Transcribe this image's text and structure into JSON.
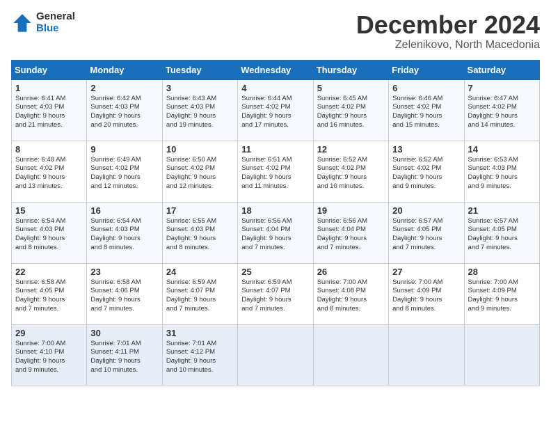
{
  "logo": {
    "general": "General",
    "blue": "Blue"
  },
  "title": "December 2024",
  "location": "Zelenikovo, North Macedonia",
  "headers": [
    "Sunday",
    "Monday",
    "Tuesday",
    "Wednesday",
    "Thursday",
    "Friday",
    "Saturday"
  ],
  "weeks": [
    [
      {
        "day": "1",
        "lines": [
          "Sunrise: 6:41 AM",
          "Sunset: 4:03 PM",
          "Daylight: 9 hours",
          "and 21 minutes."
        ]
      },
      {
        "day": "2",
        "lines": [
          "Sunrise: 6:42 AM",
          "Sunset: 4:03 PM",
          "Daylight: 9 hours",
          "and 20 minutes."
        ]
      },
      {
        "day": "3",
        "lines": [
          "Sunrise: 6:43 AM",
          "Sunset: 4:03 PM",
          "Daylight: 9 hours",
          "and 19 minutes."
        ]
      },
      {
        "day": "4",
        "lines": [
          "Sunrise: 6:44 AM",
          "Sunset: 4:02 PM",
          "Daylight: 9 hours",
          "and 17 minutes."
        ]
      },
      {
        "day": "5",
        "lines": [
          "Sunrise: 6:45 AM",
          "Sunset: 4:02 PM",
          "Daylight: 9 hours",
          "and 16 minutes."
        ]
      },
      {
        "day": "6",
        "lines": [
          "Sunrise: 6:46 AM",
          "Sunset: 4:02 PM",
          "Daylight: 9 hours",
          "and 15 minutes."
        ]
      },
      {
        "day": "7",
        "lines": [
          "Sunrise: 6:47 AM",
          "Sunset: 4:02 PM",
          "Daylight: 9 hours",
          "and 14 minutes."
        ]
      }
    ],
    [
      {
        "day": "8",
        "lines": [
          "Sunrise: 6:48 AM",
          "Sunset: 4:02 PM",
          "Daylight: 9 hours",
          "and 13 minutes."
        ]
      },
      {
        "day": "9",
        "lines": [
          "Sunrise: 6:49 AM",
          "Sunset: 4:02 PM",
          "Daylight: 9 hours",
          "and 12 minutes."
        ]
      },
      {
        "day": "10",
        "lines": [
          "Sunrise: 6:50 AM",
          "Sunset: 4:02 PM",
          "Daylight: 9 hours",
          "and 12 minutes."
        ]
      },
      {
        "day": "11",
        "lines": [
          "Sunrise: 6:51 AM",
          "Sunset: 4:02 PM",
          "Daylight: 9 hours",
          "and 11 minutes."
        ]
      },
      {
        "day": "12",
        "lines": [
          "Sunrise: 6:52 AM",
          "Sunset: 4:02 PM",
          "Daylight: 9 hours",
          "and 10 minutes."
        ]
      },
      {
        "day": "13",
        "lines": [
          "Sunrise: 6:52 AM",
          "Sunset: 4:02 PM",
          "Daylight: 9 hours",
          "and 9 minutes."
        ]
      },
      {
        "day": "14",
        "lines": [
          "Sunrise: 6:53 AM",
          "Sunset: 4:03 PM",
          "Daylight: 9 hours",
          "and 9 minutes."
        ]
      }
    ],
    [
      {
        "day": "15",
        "lines": [
          "Sunrise: 6:54 AM",
          "Sunset: 4:03 PM",
          "Daylight: 9 hours",
          "and 8 minutes."
        ]
      },
      {
        "day": "16",
        "lines": [
          "Sunrise: 6:54 AM",
          "Sunset: 4:03 PM",
          "Daylight: 9 hours",
          "and 8 minutes."
        ]
      },
      {
        "day": "17",
        "lines": [
          "Sunrise: 6:55 AM",
          "Sunset: 4:03 PM",
          "Daylight: 9 hours",
          "and 8 minutes."
        ]
      },
      {
        "day": "18",
        "lines": [
          "Sunrise: 6:56 AM",
          "Sunset: 4:04 PM",
          "Daylight: 9 hours",
          "and 7 minutes."
        ]
      },
      {
        "day": "19",
        "lines": [
          "Sunrise: 6:56 AM",
          "Sunset: 4:04 PM",
          "Daylight: 9 hours",
          "and 7 minutes."
        ]
      },
      {
        "day": "20",
        "lines": [
          "Sunrise: 6:57 AM",
          "Sunset: 4:05 PM",
          "Daylight: 9 hours",
          "and 7 minutes."
        ]
      },
      {
        "day": "21",
        "lines": [
          "Sunrise: 6:57 AM",
          "Sunset: 4:05 PM",
          "Daylight: 9 hours",
          "and 7 minutes."
        ]
      }
    ],
    [
      {
        "day": "22",
        "lines": [
          "Sunrise: 6:58 AM",
          "Sunset: 4:05 PM",
          "Daylight: 9 hours",
          "and 7 minutes."
        ]
      },
      {
        "day": "23",
        "lines": [
          "Sunrise: 6:58 AM",
          "Sunset: 4:06 PM",
          "Daylight: 9 hours",
          "and 7 minutes."
        ]
      },
      {
        "day": "24",
        "lines": [
          "Sunrise: 6:59 AM",
          "Sunset: 4:07 PM",
          "Daylight: 9 hours",
          "and 7 minutes."
        ]
      },
      {
        "day": "25",
        "lines": [
          "Sunrise: 6:59 AM",
          "Sunset: 4:07 PM",
          "Daylight: 9 hours",
          "and 7 minutes."
        ]
      },
      {
        "day": "26",
        "lines": [
          "Sunrise: 7:00 AM",
          "Sunset: 4:08 PM",
          "Daylight: 9 hours",
          "and 8 minutes."
        ]
      },
      {
        "day": "27",
        "lines": [
          "Sunrise: 7:00 AM",
          "Sunset: 4:09 PM",
          "Daylight: 9 hours",
          "and 8 minutes."
        ]
      },
      {
        "day": "28",
        "lines": [
          "Sunrise: 7:00 AM",
          "Sunset: 4:09 PM",
          "Daylight: 9 hours",
          "and 9 minutes."
        ]
      }
    ],
    [
      {
        "day": "29",
        "lines": [
          "Sunrise: 7:00 AM",
          "Sunset: 4:10 PM",
          "Daylight: 9 hours",
          "and 9 minutes."
        ]
      },
      {
        "day": "30",
        "lines": [
          "Sunrise: 7:01 AM",
          "Sunset: 4:11 PM",
          "Daylight: 9 hours",
          "and 10 minutes."
        ]
      },
      {
        "day": "31",
        "lines": [
          "Sunrise: 7:01 AM",
          "Sunset: 4:12 PM",
          "Daylight: 9 hours",
          "and 10 minutes."
        ]
      },
      null,
      null,
      null,
      null
    ]
  ]
}
